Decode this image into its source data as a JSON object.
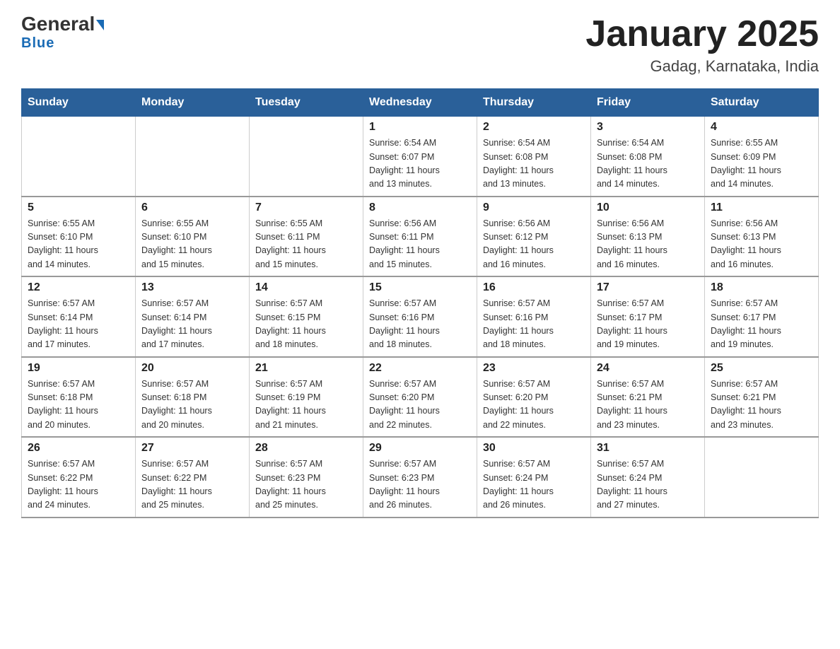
{
  "header": {
    "logo_main": "General",
    "logo_blue": "Blue",
    "month_title": "January 2025",
    "location": "Gadag, Karnataka, India"
  },
  "days_of_week": [
    "Sunday",
    "Monday",
    "Tuesday",
    "Wednesday",
    "Thursday",
    "Friday",
    "Saturday"
  ],
  "weeks": [
    [
      {
        "day": "",
        "info": ""
      },
      {
        "day": "",
        "info": ""
      },
      {
        "day": "",
        "info": ""
      },
      {
        "day": "1",
        "info": "Sunrise: 6:54 AM\nSunset: 6:07 PM\nDaylight: 11 hours\nand 13 minutes."
      },
      {
        "day": "2",
        "info": "Sunrise: 6:54 AM\nSunset: 6:08 PM\nDaylight: 11 hours\nand 13 minutes."
      },
      {
        "day": "3",
        "info": "Sunrise: 6:54 AM\nSunset: 6:08 PM\nDaylight: 11 hours\nand 14 minutes."
      },
      {
        "day": "4",
        "info": "Sunrise: 6:55 AM\nSunset: 6:09 PM\nDaylight: 11 hours\nand 14 minutes."
      }
    ],
    [
      {
        "day": "5",
        "info": "Sunrise: 6:55 AM\nSunset: 6:10 PM\nDaylight: 11 hours\nand 14 minutes."
      },
      {
        "day": "6",
        "info": "Sunrise: 6:55 AM\nSunset: 6:10 PM\nDaylight: 11 hours\nand 15 minutes."
      },
      {
        "day": "7",
        "info": "Sunrise: 6:55 AM\nSunset: 6:11 PM\nDaylight: 11 hours\nand 15 minutes."
      },
      {
        "day": "8",
        "info": "Sunrise: 6:56 AM\nSunset: 6:11 PM\nDaylight: 11 hours\nand 15 minutes."
      },
      {
        "day": "9",
        "info": "Sunrise: 6:56 AM\nSunset: 6:12 PM\nDaylight: 11 hours\nand 16 minutes."
      },
      {
        "day": "10",
        "info": "Sunrise: 6:56 AM\nSunset: 6:13 PM\nDaylight: 11 hours\nand 16 minutes."
      },
      {
        "day": "11",
        "info": "Sunrise: 6:56 AM\nSunset: 6:13 PM\nDaylight: 11 hours\nand 16 minutes."
      }
    ],
    [
      {
        "day": "12",
        "info": "Sunrise: 6:57 AM\nSunset: 6:14 PM\nDaylight: 11 hours\nand 17 minutes."
      },
      {
        "day": "13",
        "info": "Sunrise: 6:57 AM\nSunset: 6:14 PM\nDaylight: 11 hours\nand 17 minutes."
      },
      {
        "day": "14",
        "info": "Sunrise: 6:57 AM\nSunset: 6:15 PM\nDaylight: 11 hours\nand 18 minutes."
      },
      {
        "day": "15",
        "info": "Sunrise: 6:57 AM\nSunset: 6:16 PM\nDaylight: 11 hours\nand 18 minutes."
      },
      {
        "day": "16",
        "info": "Sunrise: 6:57 AM\nSunset: 6:16 PM\nDaylight: 11 hours\nand 18 minutes."
      },
      {
        "day": "17",
        "info": "Sunrise: 6:57 AM\nSunset: 6:17 PM\nDaylight: 11 hours\nand 19 minutes."
      },
      {
        "day": "18",
        "info": "Sunrise: 6:57 AM\nSunset: 6:17 PM\nDaylight: 11 hours\nand 19 minutes."
      }
    ],
    [
      {
        "day": "19",
        "info": "Sunrise: 6:57 AM\nSunset: 6:18 PM\nDaylight: 11 hours\nand 20 minutes."
      },
      {
        "day": "20",
        "info": "Sunrise: 6:57 AM\nSunset: 6:18 PM\nDaylight: 11 hours\nand 20 minutes."
      },
      {
        "day": "21",
        "info": "Sunrise: 6:57 AM\nSunset: 6:19 PM\nDaylight: 11 hours\nand 21 minutes."
      },
      {
        "day": "22",
        "info": "Sunrise: 6:57 AM\nSunset: 6:20 PM\nDaylight: 11 hours\nand 22 minutes."
      },
      {
        "day": "23",
        "info": "Sunrise: 6:57 AM\nSunset: 6:20 PM\nDaylight: 11 hours\nand 22 minutes."
      },
      {
        "day": "24",
        "info": "Sunrise: 6:57 AM\nSunset: 6:21 PM\nDaylight: 11 hours\nand 23 minutes."
      },
      {
        "day": "25",
        "info": "Sunrise: 6:57 AM\nSunset: 6:21 PM\nDaylight: 11 hours\nand 23 minutes."
      }
    ],
    [
      {
        "day": "26",
        "info": "Sunrise: 6:57 AM\nSunset: 6:22 PM\nDaylight: 11 hours\nand 24 minutes."
      },
      {
        "day": "27",
        "info": "Sunrise: 6:57 AM\nSunset: 6:22 PM\nDaylight: 11 hours\nand 25 minutes."
      },
      {
        "day": "28",
        "info": "Sunrise: 6:57 AM\nSunset: 6:23 PM\nDaylight: 11 hours\nand 25 minutes."
      },
      {
        "day": "29",
        "info": "Sunrise: 6:57 AM\nSunset: 6:23 PM\nDaylight: 11 hours\nand 26 minutes."
      },
      {
        "day": "30",
        "info": "Sunrise: 6:57 AM\nSunset: 6:24 PM\nDaylight: 11 hours\nand 26 minutes."
      },
      {
        "day": "31",
        "info": "Sunrise: 6:57 AM\nSunset: 6:24 PM\nDaylight: 11 hours\nand 27 minutes."
      },
      {
        "day": "",
        "info": ""
      }
    ]
  ]
}
